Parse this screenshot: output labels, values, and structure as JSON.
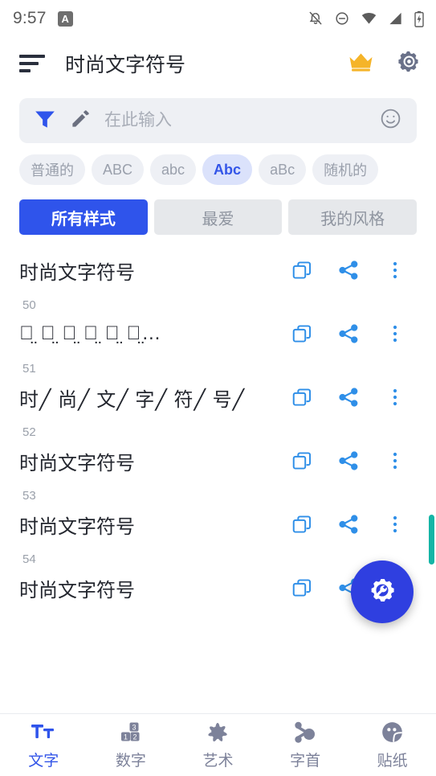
{
  "statusbar": {
    "time": "9:57",
    "app_badge": "A",
    "icons": [
      "bell-off-icon",
      "do-not-disturb-icon",
      "wifi-icon",
      "cellular-signal-icon",
      "battery-charging-icon"
    ]
  },
  "appbar": {
    "menu_icon": "sort-menu-icon",
    "title": "时尚文字符号",
    "crown_icon": "crown-icon",
    "settings_icon": "gear-icon",
    "crown_color": "#f5b429",
    "settings_color": "#6a7189"
  },
  "search": {
    "filter_icon": "filter-funnel-icon",
    "edit_icon": "pencil-icon",
    "emoji_icon": "smiley-icon",
    "value": "",
    "placeholder": "在此输入",
    "filter_color": "#2f54eb"
  },
  "case_chips": [
    {
      "label": "普通的",
      "active": false
    },
    {
      "label": "ABC",
      "active": false
    },
    {
      "label": "abc",
      "active": false
    },
    {
      "label": "Abc",
      "active": true
    },
    {
      "label": "aBc",
      "active": false
    },
    {
      "label": "随机的",
      "active": false
    }
  ],
  "segmented_tabs": [
    {
      "label": "所有样式",
      "active": true
    },
    {
      "label": "最爱",
      "active": false
    },
    {
      "label": "我的风格",
      "active": false
    }
  ],
  "list": {
    "copy_icon": "copy-icon",
    "share_icon": "share-icon",
    "more_icon": "more-vertical-icon",
    "accent": "#2f8fe8",
    "rows": [
      {
        "num": "",
        "text": "时尚文字符号"
      },
      {
        "num": "50",
        "text": "时̤ 尚̤ 文̤ 字̤ 符̤ 号̤…"
      },
      {
        "num": "51",
        "text": "时╱ 尚╱ 文╱ 字╱ 符╱ 号╱"
      },
      {
        "num": "52",
        "text": "时尚文字符号"
      },
      {
        "num": "53",
        "text": "时尚文字符号"
      },
      {
        "num": "54",
        "text": "时尚文字符号"
      }
    ]
  },
  "scrollbar": {
    "color": "#15b5a6"
  },
  "fab": {
    "icon": "gear-wrench-icon",
    "color": "#2f3fe0"
  },
  "bottom_nav": [
    {
      "label": "文字",
      "icon": "text-tt-icon",
      "active": true
    },
    {
      "label": "数字",
      "icon": "number-blocks-icon",
      "active": false
    },
    {
      "label": "艺术",
      "icon": "flower-art-icon",
      "active": false
    },
    {
      "label": "字首",
      "icon": "initial-letter-icon",
      "active": false
    },
    {
      "label": "贴纸",
      "icon": "sticker-smiley-icon",
      "active": false
    }
  ]
}
